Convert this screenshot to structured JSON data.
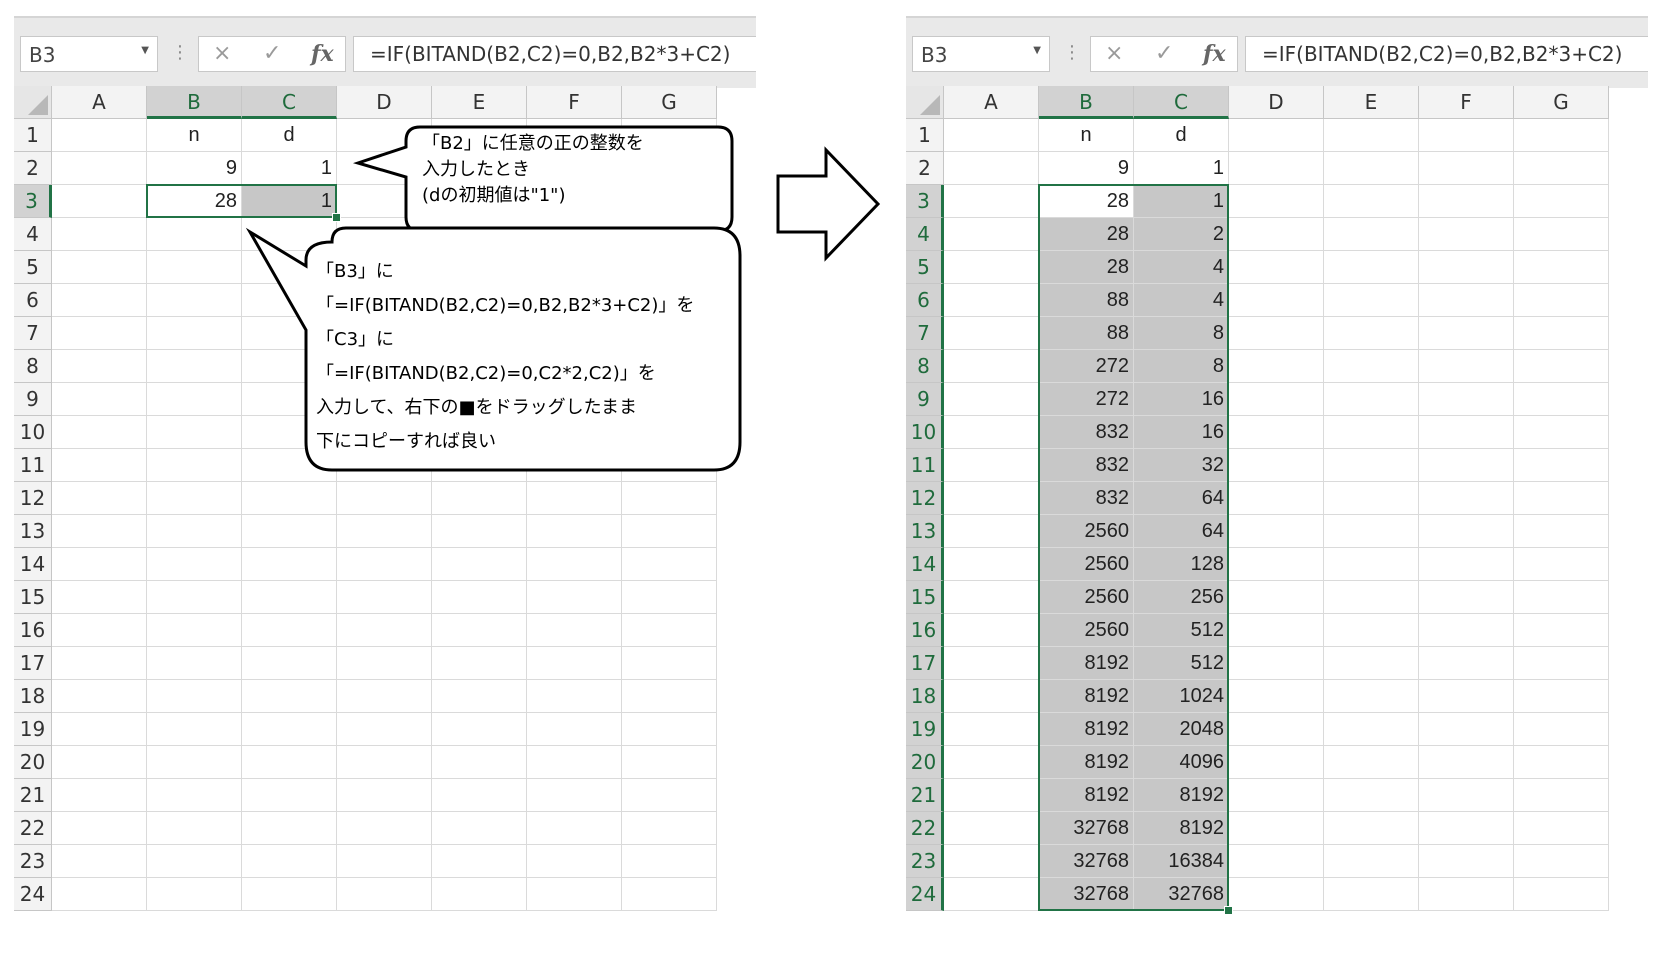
{
  "formula_bar": {
    "name_box": "B3",
    "cancel_icon": "×",
    "enter_icon": "✓",
    "fx_label": "fx",
    "formula": "=IF(BITAND(B2,C2)=0,B2,B2*3+C2)"
  },
  "columns": [
    "A",
    "B",
    "C",
    "D",
    "E",
    "F",
    "G"
  ],
  "rows": [
    "1",
    "2",
    "3",
    "4",
    "5",
    "6",
    "7",
    "8",
    "9",
    "10",
    "11",
    "12",
    "13",
    "14",
    "15",
    "16",
    "17",
    "18",
    "19",
    "20",
    "21",
    "22",
    "23",
    "24"
  ],
  "headers": {
    "n": "n",
    "d": "d"
  },
  "left": {
    "b2": "9",
    "c2": "1",
    "b3": "28",
    "c3": "1"
  },
  "callout1": {
    "lines": [
      "「B2」に任意の正の整数を",
      "入力したとき",
      "(dの初期値は\"1\")"
    ]
  },
  "callout2": {
    "lines": [
      "「B3」に",
      "「=IF(BITAND(B2,C2)=0,B2,B2*3+C2)」を",
      "「C3」に",
      "「=IF(BITAND(B2,C2)=0,C2*2,C2)」を",
      "入力して、右下の■をドラッグしたまま",
      "下にコピーすれば良い"
    ]
  },
  "right": {
    "b2": "9",
    "c2": "1",
    "b_values": [
      "28",
      "28",
      "28",
      "88",
      "88",
      "272",
      "272",
      "832",
      "832",
      "832",
      "2560",
      "2560",
      "2560",
      "2560",
      "8192",
      "8192",
      "8192",
      "8192",
      "8192",
      "32768",
      "32768",
      "32768"
    ],
    "c_values": [
      "1",
      "2",
      "4",
      "4",
      "8",
      "8",
      "16",
      "16",
      "32",
      "64",
      "64",
      "128",
      "256",
      "512",
      "512",
      "1024",
      "2048",
      "4096",
      "8192",
      "8192",
      "16384",
      "32768"
    ]
  },
  "colors": {
    "selection": "#217346",
    "gray_fill": "#c7c7c7"
  },
  "icons": [
    "dropdown-arrow-icon",
    "vertical-dots-icon",
    "cancel-icon",
    "enter-icon",
    "fx-icon",
    "select-all-icon",
    "right-arrow-icon"
  ]
}
